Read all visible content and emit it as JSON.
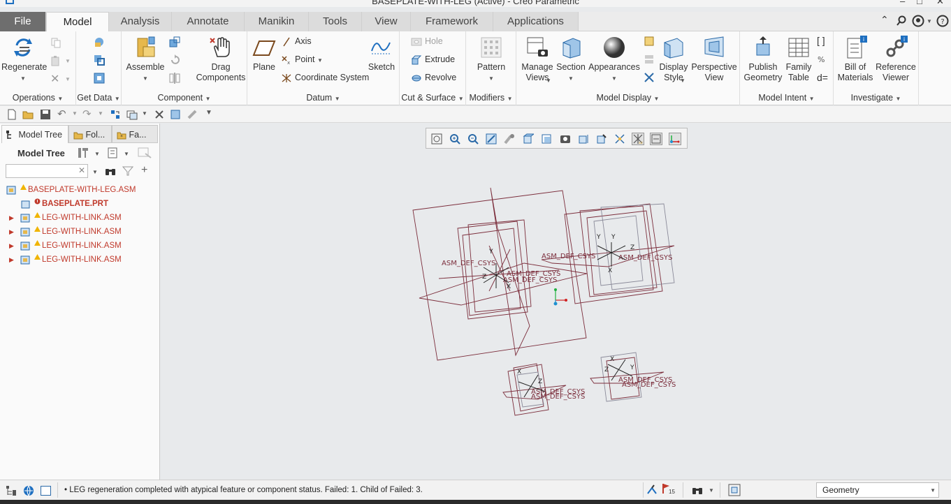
{
  "window": {
    "title": "BASEPLATE-WITH-LEG (Active) - Creo Parametric"
  },
  "tabs": [
    "File",
    "Model",
    "Analysis",
    "Annotate",
    "Manikin",
    "Tools",
    "View",
    "Framework",
    "Applications"
  ],
  "ribbon": {
    "operations": {
      "regenerate": "Regenerate",
      "group": "Operations"
    },
    "get_data": {
      "group": "Get Data"
    },
    "component": {
      "assemble": "Assemble",
      "drag": "Drag\nComponents",
      "group": "Component"
    },
    "datum": {
      "plane": "Plane",
      "axis": "Axis",
      "point": "Point",
      "csys": "Coordinate System",
      "sketch": "Sketch",
      "group": "Datum"
    },
    "cut_surface": {
      "hole": "Hole",
      "extrude": "Extrude",
      "revolve": "Revolve",
      "group": "Cut & Surface"
    },
    "modifiers": {
      "pattern": "Pattern",
      "group": "Modifiers"
    },
    "model_display": {
      "manage_views": "Manage\nViews",
      "section": "Section",
      "appearances": "Appearances",
      "display_style": "Display\nStyle",
      "perspective": "Perspective\nView",
      "group": "Model Display"
    },
    "model_intent": {
      "publish": "Publish\nGeometry",
      "family": "Family\nTable",
      "group": "Model Intent"
    },
    "investigate": {
      "bom": "Bill of\nMaterials",
      "ref_viewer": "Reference\nViewer",
      "group": "Investigate"
    }
  },
  "panel": {
    "tabs": [
      "Model Tree",
      "Fol...",
      "Fa..."
    ],
    "header": "Model Tree",
    "search_placeholder": "",
    "tree": [
      {
        "name": "BASEPLATE-WITH-LEG.ASM",
        "expand": false,
        "level": 0
      },
      {
        "name": "BASEPLATE.PRT",
        "expand": false,
        "level": 1,
        "bold": true
      },
      {
        "name": "LEG-WITH-LINK.ASM",
        "expand": true,
        "level": 1
      },
      {
        "name": "LEG-WITH-LINK.ASM",
        "expand": true,
        "level": 1
      },
      {
        "name": "LEG-WITH-LINK.ASM",
        "expand": true,
        "level": 1
      },
      {
        "name": "LEG-WITH-LINK.ASM",
        "expand": true,
        "level": 1
      }
    ]
  },
  "viewport_labels": [
    "ASM_DEF_CSYS",
    "Y",
    "X",
    "Z"
  ],
  "status": {
    "message": "LEG regeneration completed with atypical feature or component status. Failed: 1. Child of Failed: 3.",
    "flag_count": "15",
    "filter": "Geometry"
  },
  "colors": {
    "tree_text": "#c0392b",
    "datum": "#7b2d3b",
    "accent": "#1e6fc0"
  }
}
